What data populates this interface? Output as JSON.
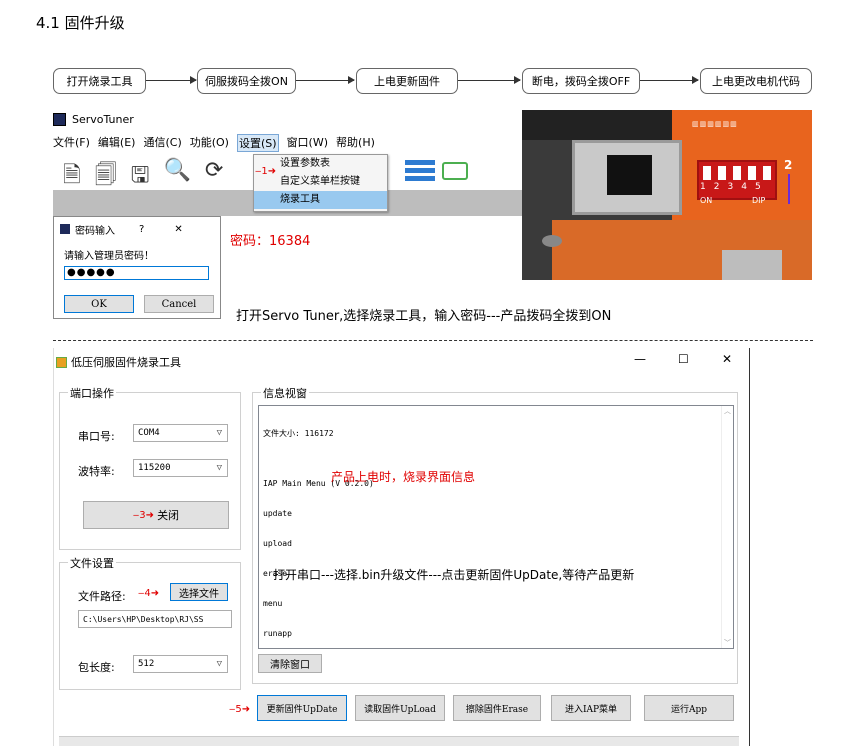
{
  "section_title": "4.1 固件升级",
  "flow": {
    "steps": [
      "打开烧录工具",
      "伺服拨码全拨ON",
      "上电更新固件",
      "断电，拨码全拨OFF",
      "上电更改电机代码"
    ]
  },
  "servotuner": {
    "app_title": "ServoTuner",
    "menu": [
      "文件(F)",
      "编辑(E)",
      "通信(C)",
      "功能(O)",
      "设置(S)",
      "窗口(W)",
      "帮助(H)"
    ],
    "dropdown_items": [
      "设置参数表",
      "自定义菜单栏按键",
      "烧录工具"
    ],
    "step1_marker": "1"
  },
  "password_dialog": {
    "title": "密码输入",
    "help": "?",
    "close": "✕",
    "prompt": "请输入管理员密码！",
    "value": "●●●●●",
    "ok": "OK",
    "cancel": "Cancel"
  },
  "password_note": "密码：16384",
  "caption1": "打开Servo Tuner,选择烧录工具，输入密码---产品拨码全拨到ON",
  "photo": {
    "dip_numbers": [
      "1",
      "2",
      "3",
      "4",
      "5"
    ],
    "on_label": "ON",
    "dip_label": "DIP",
    "step2_marker": "2"
  },
  "burn_tool": {
    "title": "低压伺服固件烧录工具",
    "win_controls": [
      "—",
      "☐",
      "✕"
    ],
    "port_group": "端口操作",
    "port_label": "串口号:",
    "port_value": "COM4",
    "baud_label": "波特率:",
    "baud_value": "115200",
    "close_button": "关闭",
    "step3_marker": "3",
    "file_group": "文件设置",
    "file_path_label": "文件路径:",
    "select_file_button": "选择文件",
    "step4_marker": "4",
    "file_path_value": "C:\\Users\\HP\\Desktop\\RJ\\SS",
    "packet_label": "包长度:",
    "packet_value": "512",
    "info_group": "信息视窗",
    "info_lines": [
      "文件大小: 116172",
      "",
      "IAP Main Menu (V 0.2.0)",
      "update",
      "upload",
      "erase",
      "menu",
      "runapp"
    ],
    "info_annotation": "产品上电时，烧录界面信息",
    "instruction": "打开串口---选择.bin升级文件---点击更新固件UpDate,等待产品更新",
    "clear_button": "清除窗口",
    "step5_marker": "5",
    "buttons": [
      "更新固件UpDate",
      "读取固件UpLoad",
      "擦除固件Erase",
      "进入IAP菜单",
      "运行App"
    ]
  },
  "colors": {
    "annotation_red": "#e00000",
    "selection_blue": "#99c9ef",
    "orange_case": "#e8641e"
  }
}
